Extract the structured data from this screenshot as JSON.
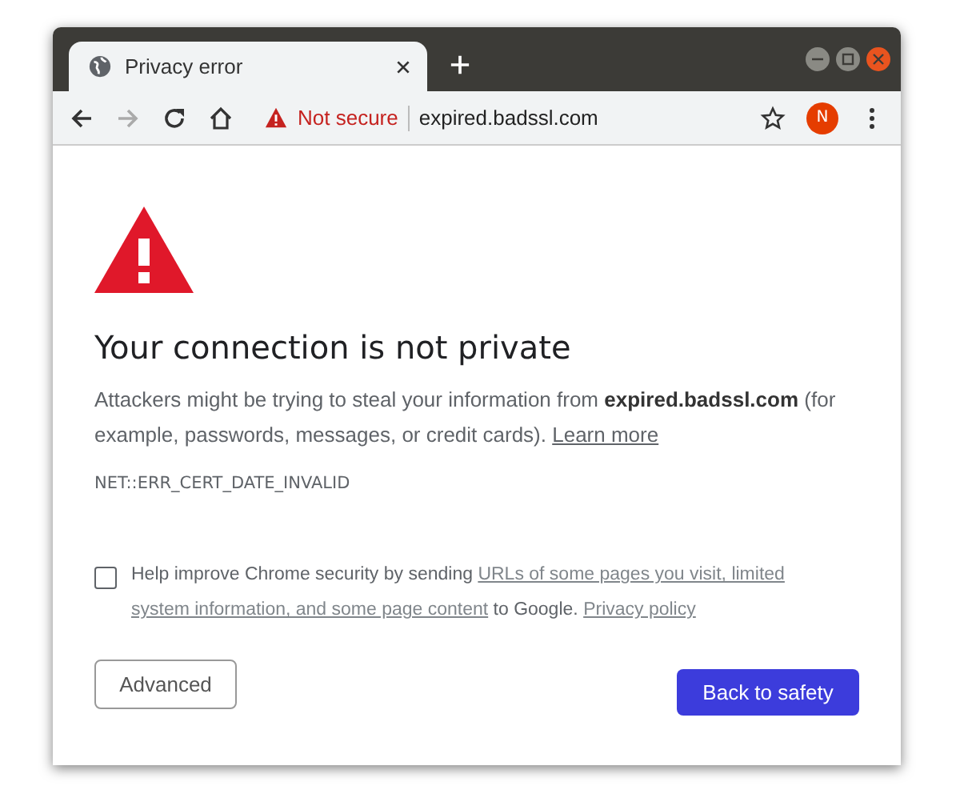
{
  "window": {
    "tab": {
      "title": "Privacy error",
      "selected": true
    }
  },
  "toolbar": {
    "security_label": "Not secure",
    "url": "expired.badssl.com",
    "profile_initial": "N"
  },
  "page": {
    "heading": "Your connection is not private",
    "summary": [
      {
        "kind": "text",
        "text": "Attackers might be trying to steal your information from **expired.badssl.com** (for example, passwords, messages, or credit cards). "
      },
      {
        "kind": "link",
        "text": "Learn more"
      }
    ],
    "error_code": "NET::ERR_CERT_DATE_INVALID",
    "opt_in": {
      "checked": false,
      "parts": [
        {
          "kind": "text",
          "text": "Help improve Chrome security by sending "
        },
        {
          "kind": "link",
          "text": "URLs of some pages you visit, limited"
        },
        {
          "kind": "break"
        },
        {
          "kind": "link",
          "text": "system information, and some page content"
        },
        {
          "kind": "text",
          "text": " to Google. "
        },
        {
          "kind": "link",
          "text": "Privacy policy"
        }
      ]
    },
    "buttons": [
      {
        "kind": "secondary",
        "label": "Advanced"
      },
      {
        "kind": "primary",
        "label": "Back to safety"
      }
    ]
  }
}
